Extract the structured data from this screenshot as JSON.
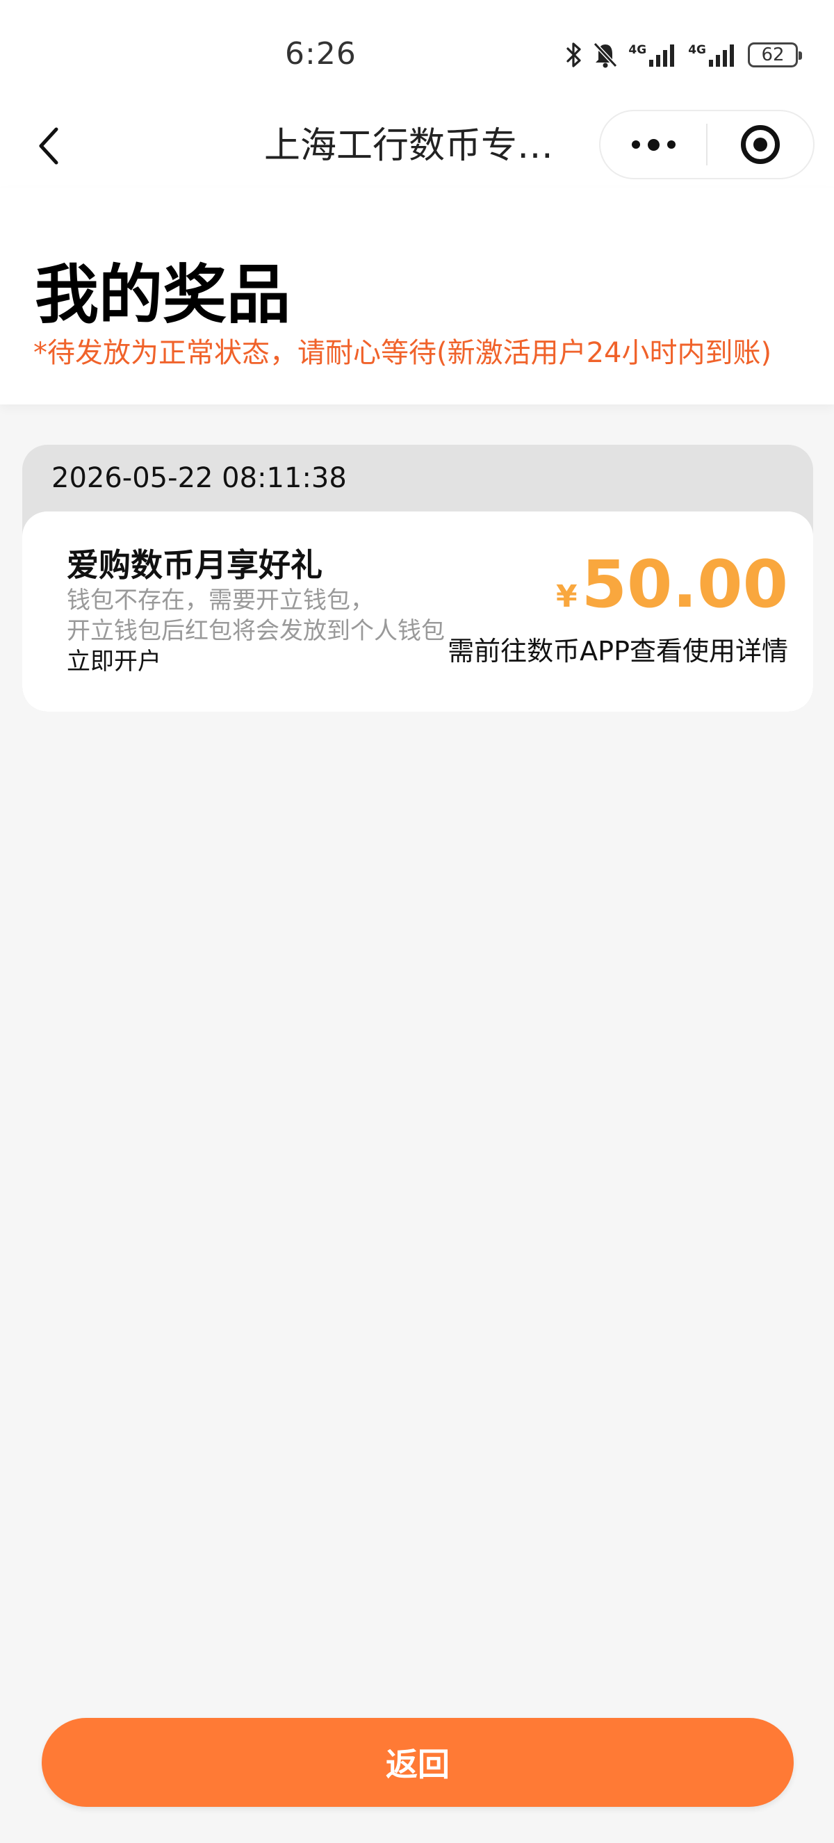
{
  "status_bar": {
    "time": "6:26",
    "network_1": "4G",
    "network_2": "4G",
    "battery": "62",
    "icons": [
      "bluetooth-icon",
      "bell-muted-icon",
      "signal-icon",
      "signal-icon",
      "battery-icon"
    ]
  },
  "nav": {
    "title": "上海工行数币专…",
    "back_icon": "chevron-left-icon",
    "more_icon": "more-dots-icon",
    "close_icon": "target-icon"
  },
  "header": {
    "title": "我的奖品",
    "notice": "*待发放为正常状态，请耐心等待(新激活用户24小时内到账)"
  },
  "prizes": [
    {
      "date": "2026-05-22 08:11:38",
      "name": "爱购数币月享好礼",
      "desc_line1": "钱包不存在，需要开立钱包，",
      "desc_line2": "开立钱包后红包将会发放到个人钱包",
      "action": "立即开户",
      "currency": "¥",
      "amount": "50.00",
      "note": "需前往数币APP查看使用详情"
    }
  ],
  "footer": {
    "return_label": "返回"
  },
  "colors": {
    "accent": "#ff7a35",
    "notice": "#f0622a",
    "amount": "#f9a73e",
    "background": "#f6f6f6"
  }
}
